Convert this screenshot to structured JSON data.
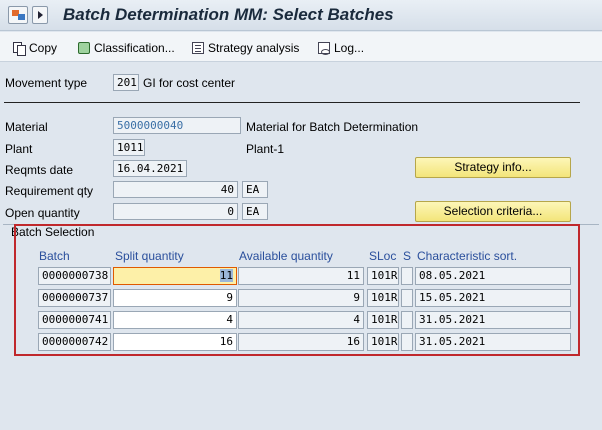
{
  "title": "Batch Determination MM: Select Batches",
  "toolbar": {
    "copy": "Copy",
    "classification": "Classification...",
    "strategy_analysis": "Strategy analysis",
    "log": "Log..."
  },
  "header": {
    "movement_type_label": "Movement type",
    "movement_type_value": "201",
    "movement_type_text": "GI for cost center"
  },
  "details": {
    "material_label": "Material",
    "material_value": "5000000040",
    "material_text": "Material for Batch Determination",
    "plant_label": "Plant",
    "plant_value": "1011",
    "plant_text": "Plant-1",
    "reqmts_date_label": "Reqmts date",
    "reqmts_date_value": "16.04.2021",
    "requirement_qty_label": "Requirement qty",
    "requirement_qty_value": "40",
    "requirement_qty_unit": "EA",
    "open_quantity_label": "Open quantity",
    "open_quantity_value": "0",
    "open_quantity_unit": "EA",
    "strategy_info_button": "Strategy info...",
    "selection_criteria_button": "Selection criteria..."
  },
  "batch_selection": {
    "title": "Batch Selection",
    "columns": {
      "batch": "Batch",
      "split_quantity": "Split quantity",
      "available_quantity": "Available quantity",
      "sloc": "SLoc",
      "s": "S",
      "characteristic_sort": "Characteristic sort."
    },
    "rows": [
      {
        "batch": "0000000738",
        "split": "11",
        "available": "11",
        "sloc": "101R",
        "s": "",
        "char_sort": "08.05.2021"
      },
      {
        "batch": "0000000737",
        "split": "9",
        "available": "9",
        "sloc": "101R",
        "s": "",
        "char_sort": "15.05.2021"
      },
      {
        "batch": "0000000741",
        "split": "4",
        "available": "4",
        "sloc": "101R",
        "s": "",
        "char_sort": "31.05.2021"
      },
      {
        "batch": "0000000742",
        "split": "16",
        "available": "16",
        "sloc": "101R",
        "s": "",
        "char_sort": "31.05.2021"
      }
    ]
  }
}
